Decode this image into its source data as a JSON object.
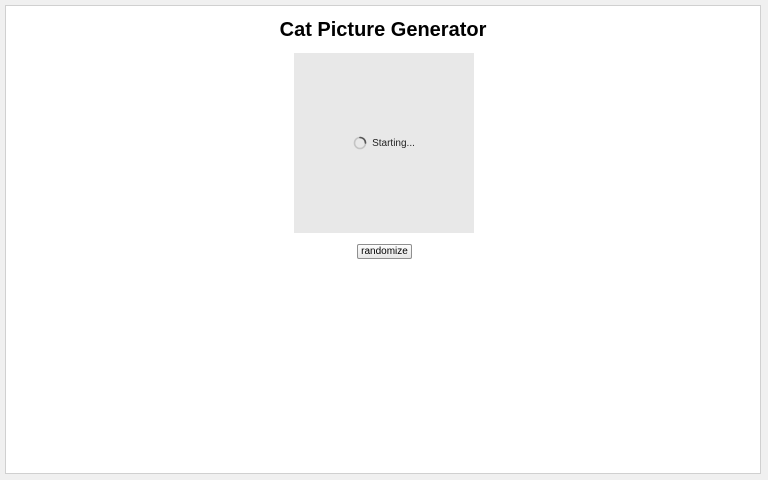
{
  "page": {
    "title": "Cat Picture Generator"
  },
  "image_panel": {
    "status_text": "Starting...",
    "background_color": "#e8e8e8",
    "spinner_icon": "loading-spinner-icon"
  },
  "controls": {
    "randomize_label": "randomize"
  }
}
